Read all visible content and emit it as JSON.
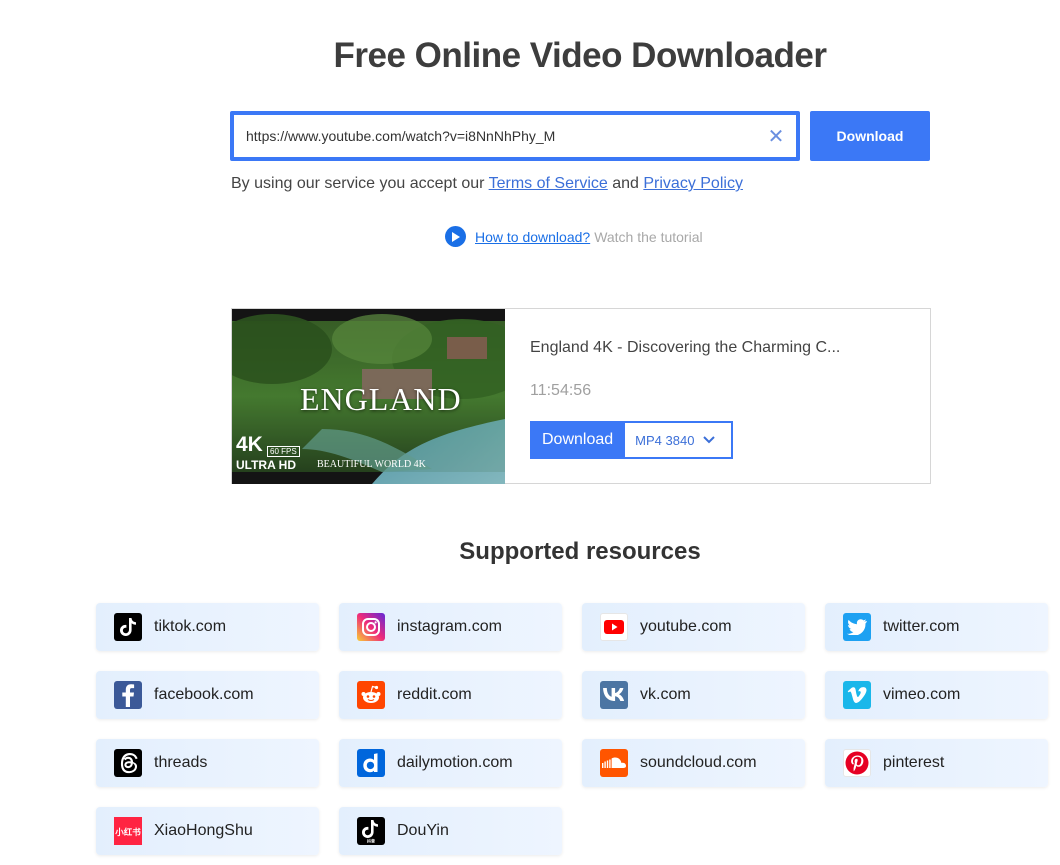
{
  "title": "Free Online Video Downloader",
  "search": {
    "value": "https://www.youtube.com/watch?v=i8NnNhPhy_M",
    "clear_glyph": "✕",
    "download_label": "Download"
  },
  "terms": {
    "prefix": "By using our service you accept our ",
    "tos": "Terms of Service",
    "and": " and ",
    "privacy": "Privacy Policy"
  },
  "howto": {
    "link": "How to download?",
    "hint": "Watch the tutorial"
  },
  "result": {
    "title": "England 4K - Discovering the Charming C...",
    "duration": "11:54:56",
    "download_label": "Download",
    "format": "MP4 3840",
    "thumbnail": {
      "headline": "ENGLAND",
      "badge_4k": "4K",
      "badge_fps": "60 FPS",
      "badge_uhd": "ULTRA HD",
      "tagline": "BEAUTIFUL WORLD 4K"
    }
  },
  "supported": {
    "title": "Supported resources",
    "items": [
      {
        "label": "tiktok.com",
        "icon": "tiktok-icon",
        "color": "#000000"
      },
      {
        "label": "instagram.com",
        "icon": "instagram-icon",
        "color": "#d62976"
      },
      {
        "label": "youtube.com",
        "icon": "youtube-icon",
        "color": "#ff0000"
      },
      {
        "label": "twitter.com",
        "icon": "twitter-icon",
        "color": "#1da1f2"
      },
      {
        "label": "facebook.com",
        "icon": "facebook-icon",
        "color": "#3b5998"
      },
      {
        "label": "reddit.com",
        "icon": "reddit-icon",
        "color": "#ff4500"
      },
      {
        "label": "vk.com",
        "icon": "vk-icon",
        "color": "#4c75a3"
      },
      {
        "label": "vimeo.com",
        "icon": "vimeo-icon",
        "color": "#1ab7ea"
      },
      {
        "label": "threads",
        "icon": "threads-icon",
        "color": "#000000"
      },
      {
        "label": "dailymotion.com",
        "icon": "dailymotion-icon",
        "color": "#0066dc"
      },
      {
        "label": "soundcloud.com",
        "icon": "soundcloud-icon",
        "color": "#ff5500"
      },
      {
        "label": "pinterest",
        "icon": "pinterest-icon",
        "color": "#e60023"
      },
      {
        "label": "XiaoHongShu",
        "icon": "xiaohongshu-icon",
        "color": "#ff2442"
      },
      {
        "label": "DouYin",
        "icon": "douyin-icon",
        "color": "#000000"
      }
    ]
  },
  "colors": {
    "accent": "#3b78f6",
    "link": "#3b6fd8"
  }
}
